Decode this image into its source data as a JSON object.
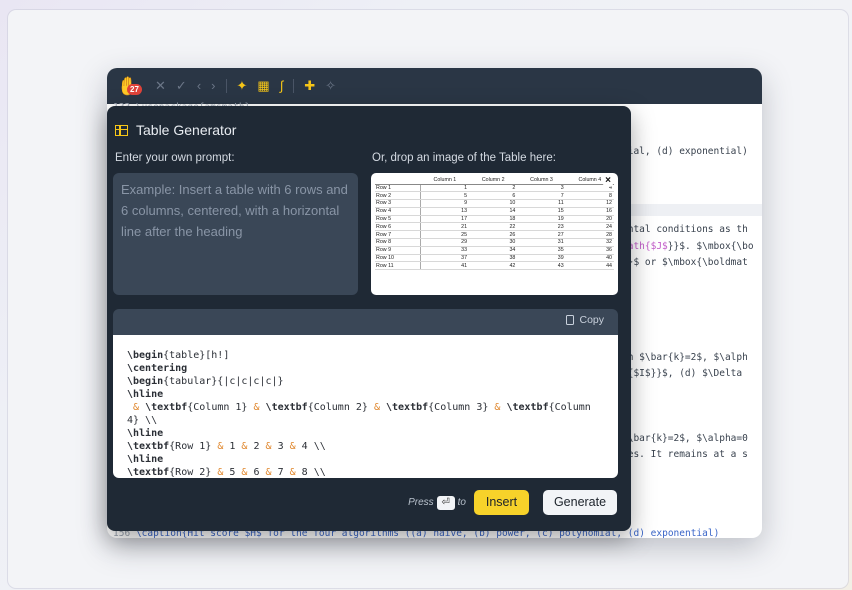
{
  "toolbar": {
    "notification_count": "27",
    "icons": [
      "logo-icon",
      "close-icon",
      "check-icon",
      "chevron-left-icon",
      "chevron-right-icon",
      "sparkle-icon",
      "table-icon",
      "integral-icon",
      "gift-icon",
      "magic-wand-icon"
    ]
  },
  "editor": {
    "line_top": "133   \\usepackage{amsmath}",
    "line_a": "mial, (d) exponential)",
    "line_b": "ental conditions as th",
    "line_c_prefix": "math{",
    "line_c_mid": "$J$",
    "line_c_suffix": "}}$. $\\mbox{\\bo",
    "line_d": "}}$ or $\\mbox{\\boldmat",
    "line_e": "en $\\bar{k}=2$, $\\alph",
    "line_f": "h{$I$}}$, (d) $\\Delta ",
    "line_g": "$\\bar{k}=2$, $\\alpha=0",
    "line_h": "ses. It remains at a s",
    "line_bottom_num": "156",
    "line_bottom": "\\caption{Hit score $H$ for the four algorithms ((a) naive, (b) power, (c) polynomial, (d) exponential)"
  },
  "dialog": {
    "title": "Table Generator",
    "prompt_label": "Enter your own prompt:",
    "drop_label": "Or, drop an image of the Table here:",
    "prompt_placeholder": "Example: Insert a table with 6 rows and 6 columns, centered, with a horizontal line after the heading",
    "copy_label": "Copy",
    "press_text": "Press",
    "to_text": "to",
    "enter_glyph": "⏎",
    "insert_label": "Insert",
    "generate_label": "Generate"
  },
  "preview_table": {
    "headers": [
      "",
      "Column 1",
      "Column 2",
      "Column 3",
      "Column 4"
    ],
    "rows": [
      [
        "Row 1",
        "1",
        "2",
        "3",
        "4"
      ],
      [
        "Row 2",
        "5",
        "6",
        "7",
        "8"
      ],
      [
        "Row 3",
        "9",
        "10",
        "11",
        "12"
      ],
      [
        "Row 4",
        "13",
        "14",
        "15",
        "16"
      ],
      [
        "Row 5",
        "17",
        "18",
        "19",
        "20"
      ],
      [
        "Row 6",
        "21",
        "22",
        "23",
        "24"
      ],
      [
        "Row 7",
        "25",
        "26",
        "27",
        "28"
      ],
      [
        "Row 8",
        "29",
        "30",
        "31",
        "32"
      ],
      [
        "Row 9",
        "33",
        "34",
        "35",
        "36"
      ],
      [
        "Row 10",
        "37",
        "38",
        "39",
        "40"
      ],
      [
        "Row 11",
        "41",
        "42",
        "43",
        "44"
      ]
    ]
  },
  "output": {
    "lines": [
      "\\begin{table}[h!]",
      "\\centering",
      "\\begin{tabular}{|c|c|c|c|}",
      "\\hline",
      " & \\textbf{Column 1} & \\textbf{Column 2} & \\textbf{Column 3} & \\textbf{Column",
      "4} \\\\",
      "\\hline",
      "\\textbf{Row 1} & 1 & 2 & 3 & 4 \\\\",
      "\\hline",
      "\\textbf{Row 2} & 5 & 6 & 7 & 8 \\\\"
    ]
  },
  "colors": {
    "accent_yellow": "#f7d22a",
    "dialog_bg": "#1f2935",
    "toolbar_bg": "#2a3645",
    "badge_red": "#e0433a"
  }
}
